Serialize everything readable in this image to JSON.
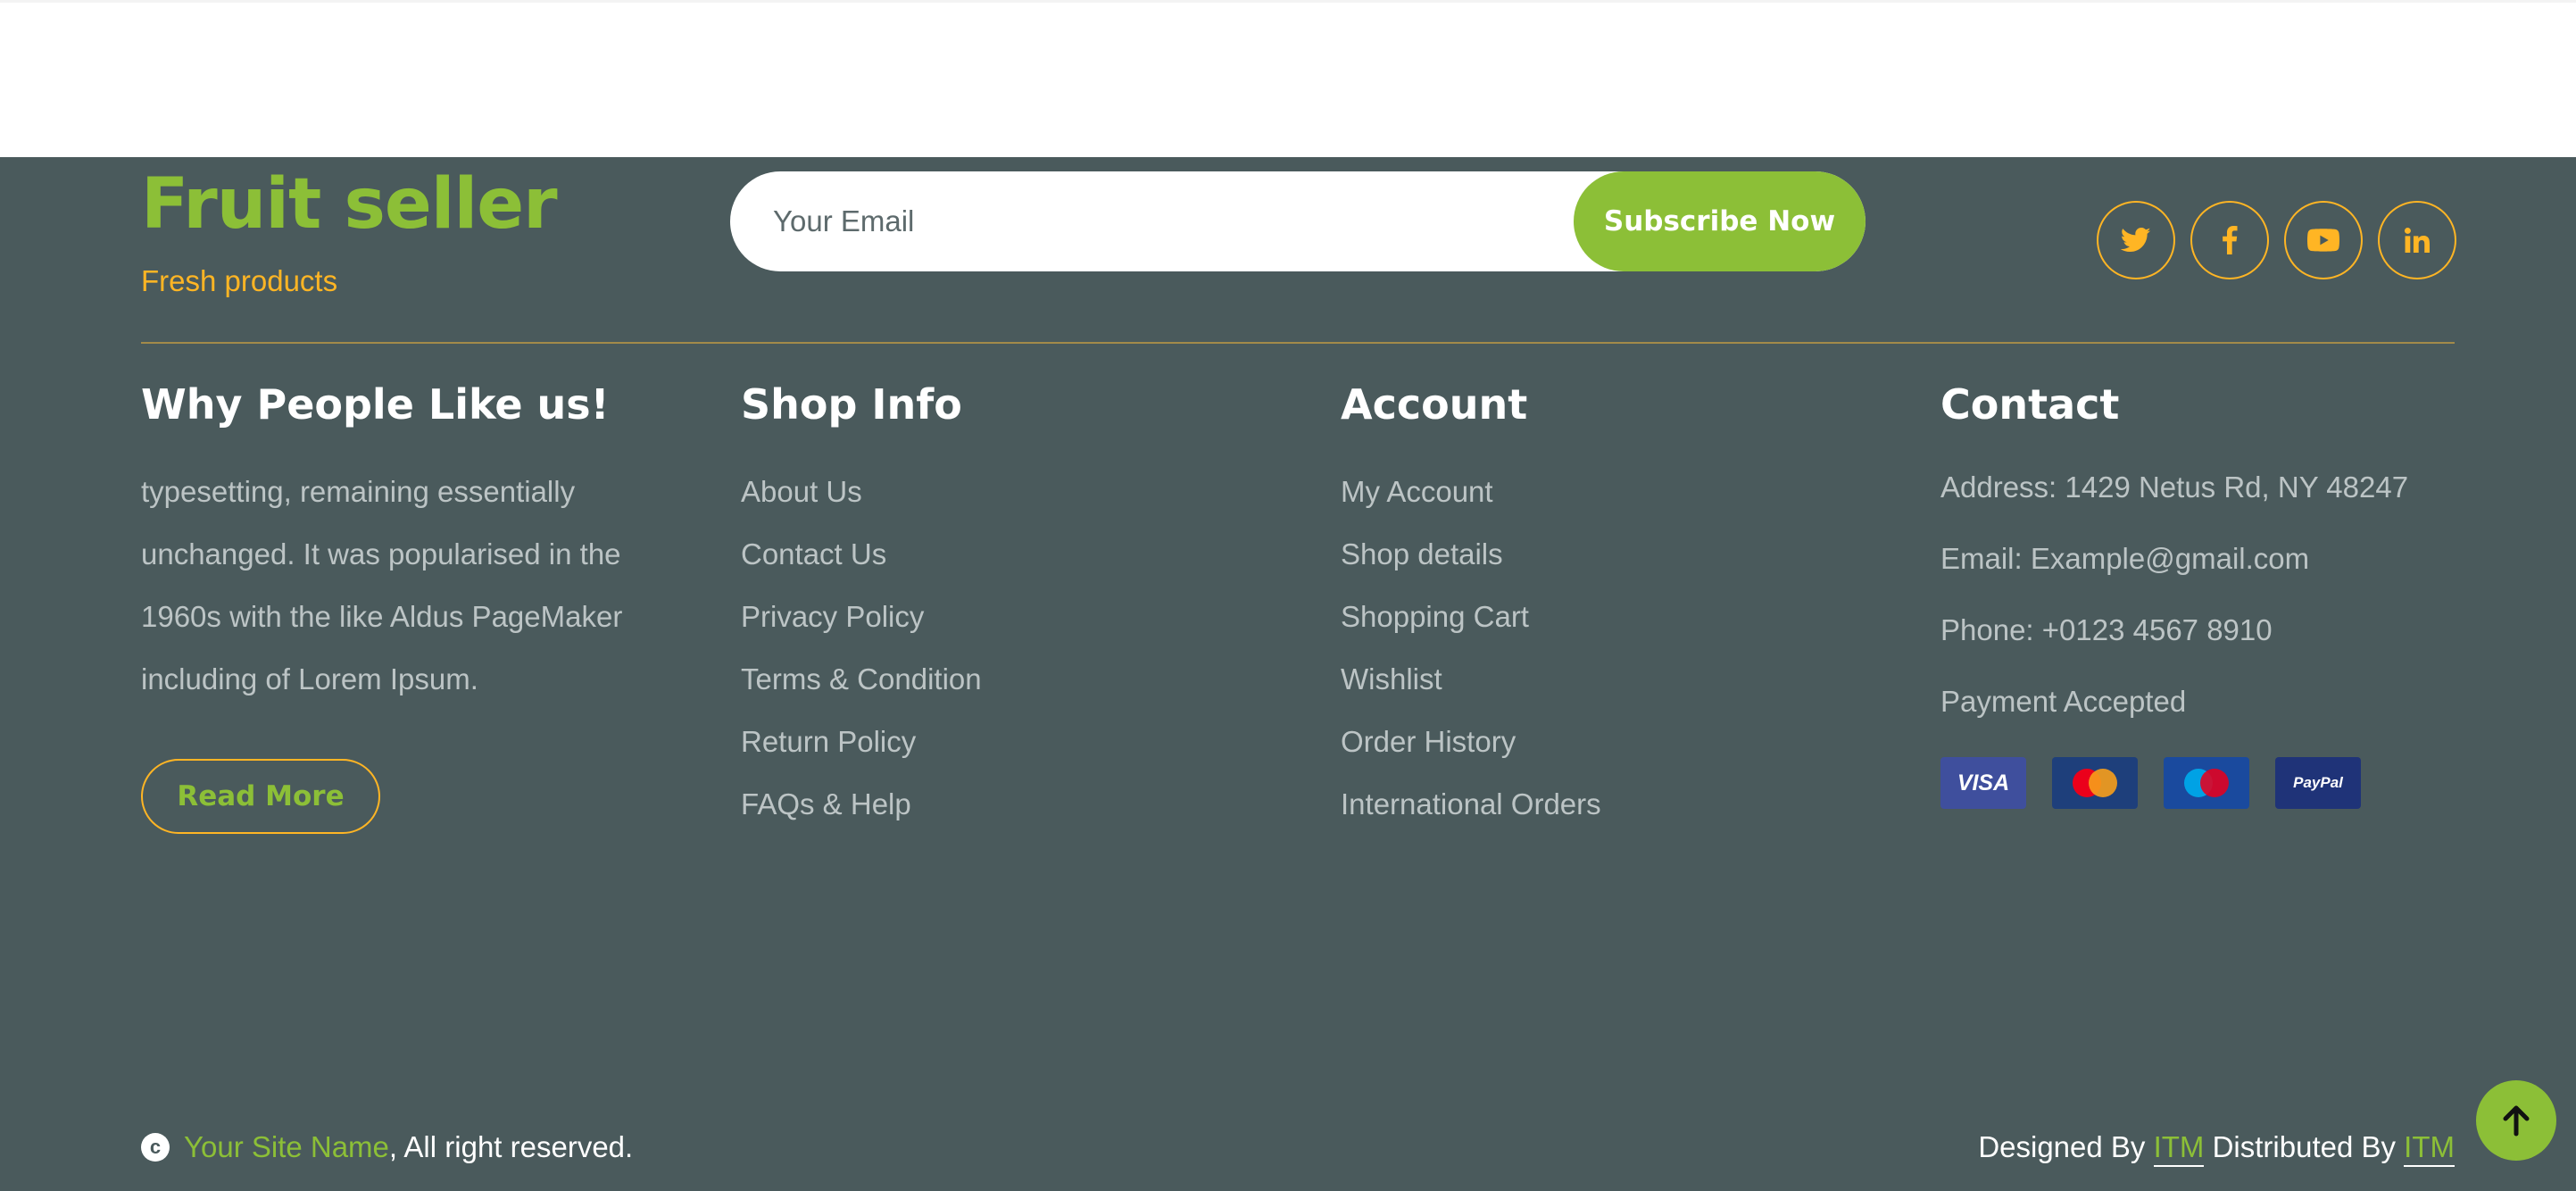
{
  "brand": {
    "title": "Fruit seller",
    "subtitle": "Fresh products"
  },
  "subscribe": {
    "placeholder": "Your Email",
    "button_label": "Subscribe Now"
  },
  "socials": [
    {
      "name": "twitter-icon"
    },
    {
      "name": "facebook-icon"
    },
    {
      "name": "youtube-icon"
    },
    {
      "name": "linkedin-icon"
    }
  ],
  "why": {
    "heading": "Why People Like us!",
    "text": "typesetting, remaining essentially unchanged. It was popularised in the 1960s with the like Aldus PageMaker including of Lorem Ipsum.",
    "button_label": "Read More"
  },
  "shop_info": {
    "heading": "Shop Info",
    "links": [
      "About Us",
      "Contact Us",
      "Privacy Policy",
      "Terms & Condition",
      "Return Policy",
      "FAQs & Help"
    ]
  },
  "account": {
    "heading": "Account",
    "links": [
      "My Account",
      "Shop details",
      "Shopping Cart",
      "Wishlist",
      "Order History",
      "International Orders"
    ]
  },
  "contact": {
    "heading": "Contact",
    "address": "Address: 1429 Netus Rd, NY 48247",
    "email": "Email: Example@gmail.com",
    "phone": "Phone: +0123 4567 8910",
    "payment_label": "Payment Accepted",
    "payment_methods": [
      {
        "name": "visa",
        "label": "VISA"
      },
      {
        "name": "mastercard",
        "label": "MasterCard"
      },
      {
        "name": "maestro",
        "label": "Maestro"
      },
      {
        "name": "paypal",
        "label": "PayPal"
      }
    ]
  },
  "bottom": {
    "copyright_symbol": "c",
    "site_name": "Your Site Name",
    "rights": ", All right reserved.",
    "designed_by": "Designed By ",
    "designer": "ITM",
    "distributed_by": " Distributed By ",
    "distributor": "ITM"
  },
  "colors": {
    "footer_bg": "#4a5a5c",
    "accent_green": "#8cbf37",
    "accent_orange": "#ffb524",
    "muted_text": "#bcc4c5"
  }
}
